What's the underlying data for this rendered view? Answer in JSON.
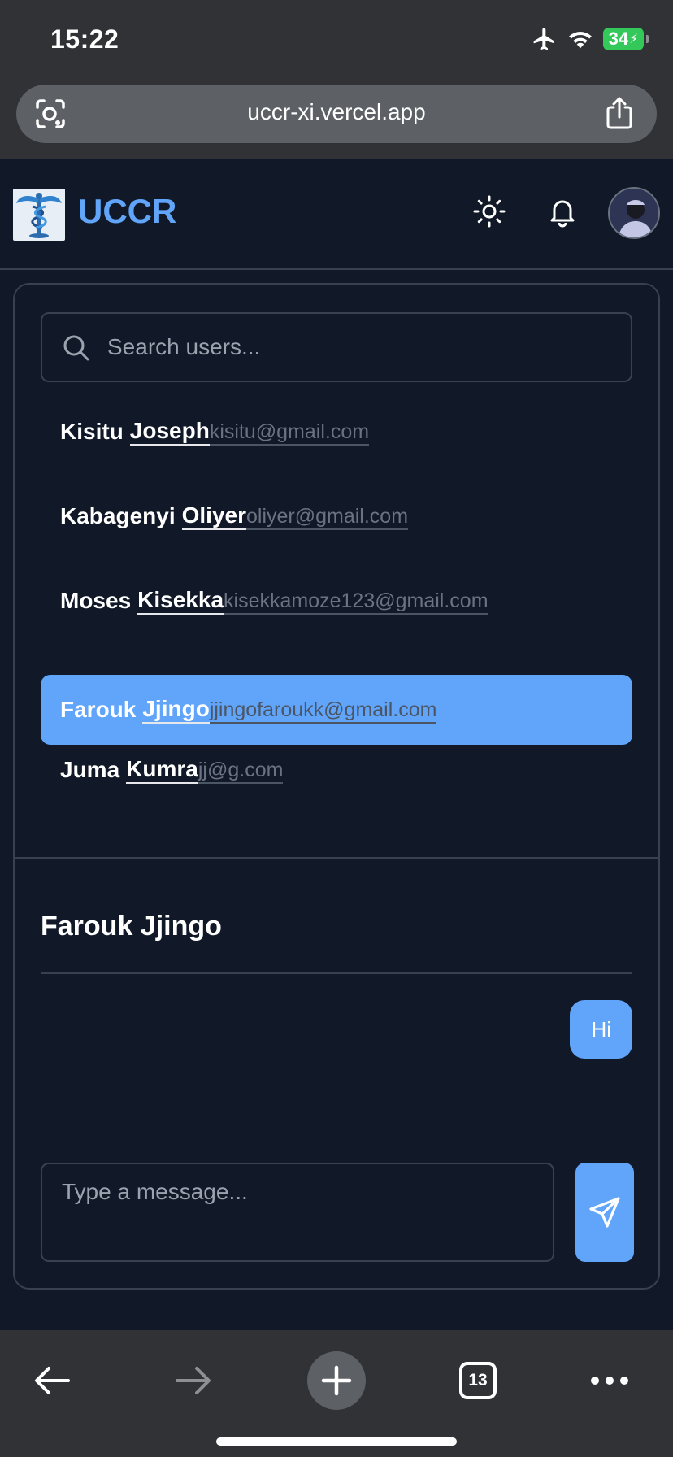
{
  "status": {
    "time": "15:22",
    "battery": "34"
  },
  "browser": {
    "url": "uccr-xi.vercel.app",
    "tab_count": "13"
  },
  "header": {
    "brand": "UCCR"
  },
  "search": {
    "placeholder": "Search users..."
  },
  "users": [
    {
      "first": "Kisitu",
      "last": "Joseph",
      "email": "kisitu@gmail.com",
      "selected": false
    },
    {
      "first": "Kabagenyi",
      "last": "Oliyer",
      "email": "oliyer@gmail.com",
      "selected": false
    },
    {
      "first": "Moses",
      "last": "Kisekka",
      "email": "kisekkamoze123@gmail.com",
      "selected": false
    },
    {
      "first": "Farouk",
      "last": "Jjingo",
      "email": "jjingofaroukk@gmail.com",
      "selected": true
    },
    {
      "first": "Juma",
      "last": "Kumra",
      "email": "jj@g.com",
      "selected": false
    }
  ],
  "chat": {
    "title": "Farouk Jjingo",
    "messages": [
      {
        "text": "Hi",
        "from": "me"
      }
    ],
    "input_placeholder": "Type a message..."
  },
  "colors": {
    "accent": "#60a5fa",
    "background": "#111827",
    "border": "#374151"
  },
  "icons": [
    "camera-search-icon",
    "share-icon",
    "sun-icon",
    "bell-icon",
    "search-icon",
    "send-icon",
    "back-icon",
    "forward-icon",
    "plus-icon",
    "tabs-icon",
    "more-icon"
  ]
}
